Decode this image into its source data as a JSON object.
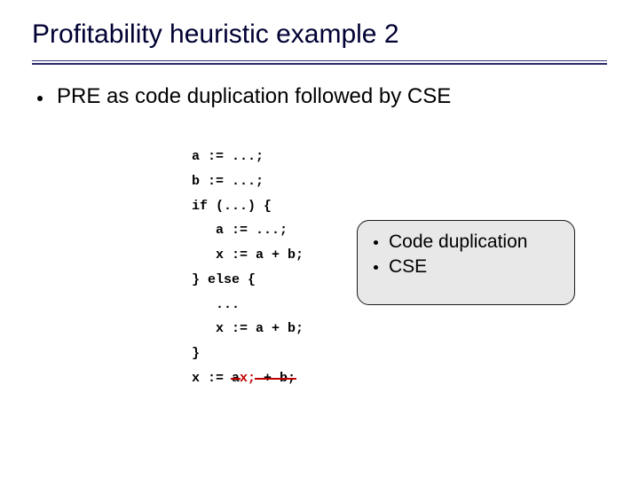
{
  "title": "Profitability heuristic example 2",
  "bullet": "PRE as code duplication followed by CSE",
  "code": {
    "l1": "a := ...;",
    "l2": "b := ...;",
    "l3": "if (...) {",
    "l4": "   a := ...;",
    "l5": "   x := a + b;",
    "l6": "} else {",
    "l7": "   ...",
    "l8": "   x := a + b;",
    "l9": "}",
    "l10a": "x := ",
    "l10b": "a",
    "l10c": "x;",
    "l10d": " + b;"
  },
  "callout": {
    "item1": "Code duplication",
    "item2": "CSE"
  }
}
